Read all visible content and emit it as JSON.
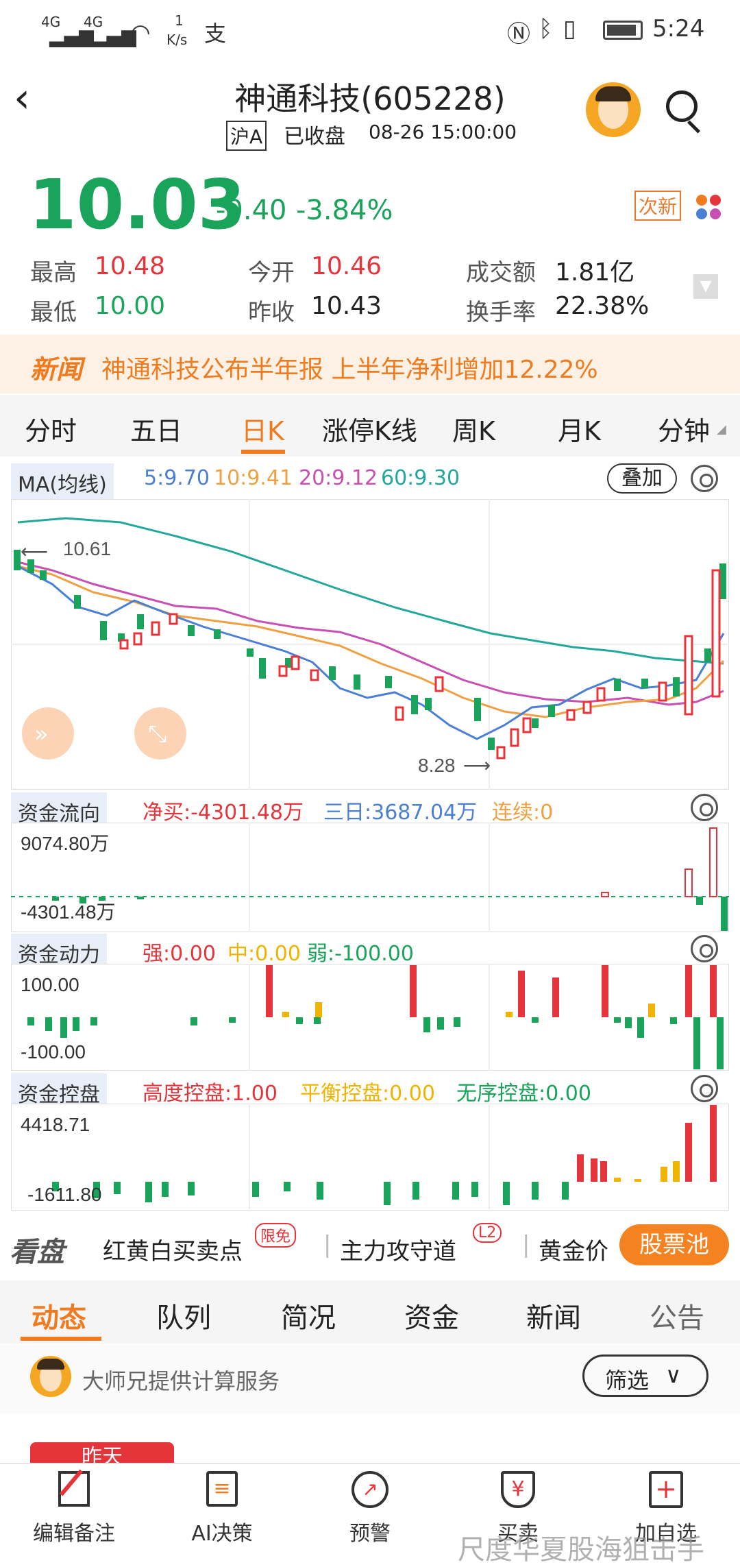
{
  "status": {
    "net1": "4G",
    "net2": "4G",
    "speed_num": "1",
    "speed_unit": "K/s",
    "time": "5:24"
  },
  "header": {
    "title": "神通科技(605228)",
    "exchange": "沪A",
    "state": "已收盘",
    "datetime": "08-26 15:00:00"
  },
  "quote": {
    "price": "10.03",
    "change": "-0.40",
    "pct": "-3.84%",
    "tag": "次新",
    "high_label": "最高",
    "high": "10.48",
    "low_label": "最低",
    "low": "10.00",
    "open_label": "今开",
    "open": "10.46",
    "prev_label": "昨收",
    "prev": "10.43",
    "amount_label": "成交额",
    "amount": "1.81亿",
    "turnover_label": "换手率",
    "turnover": "22.38%"
  },
  "news": {
    "tag": "新闻",
    "text": "神通科技公布半年报 上半年净利增加12.22%"
  },
  "period_tabs": [
    "分时",
    "五日",
    "日K",
    "涨停K线",
    "周K",
    "月K",
    "分钟"
  ],
  "ma": {
    "label": "MA(均线)",
    "ma5": "5:9.70",
    "ma10": "10:9.41",
    "ma20": "20:9.12",
    "ma60": "60:9.30",
    "overlay": "叠加",
    "c5": "#4a7fd4",
    "c10": "#f0a040",
    "c20": "#c84fb4",
    "c60": "#21a89a"
  },
  "kline": {
    "max_label": "10.61",
    "min_label": "8.28"
  },
  "flow": {
    "title": "资金流向",
    "net": "净买:-4301.48万",
    "three": "三日:3687.04万",
    "cont": "连续:0",
    "top": "9074.80万",
    "bottom": "-4301.48万"
  },
  "power": {
    "title": "资金动力",
    "strong": "强:0.00",
    "mid": "中:0.00",
    "weak": "弱:-100.00",
    "top": "100.00",
    "bottom": "-100.00"
  },
  "control": {
    "title": "资金控盘",
    "high": "高度控盘:1.00",
    "balance": "平衡控盘:0.00",
    "chaos": "无序控盘:0.00",
    "top": "4418.71",
    "bottom": "-1611.80"
  },
  "kanpan": {
    "logo": "看盘",
    "item1": "红黄白买卖点",
    "badge1": "限免",
    "item2": "主力攻守道",
    "badge2": "L2",
    "item3": "黄金价",
    "pool": "股票池"
  },
  "bottom_tabs": [
    "动态",
    "队列",
    "简况",
    "资金",
    "新闻",
    "公告"
  ],
  "feed": {
    "service": "大师兄提供计算服务",
    "filter": "筛选",
    "date_chip": "昨天"
  },
  "nav": [
    {
      "label": "编辑备注"
    },
    {
      "label": "AI决策"
    },
    {
      "label": "预警"
    },
    {
      "label": "买卖"
    },
    {
      "label": "加自选"
    }
  ],
  "watermark": "尺度华夏股海狙击手"
}
